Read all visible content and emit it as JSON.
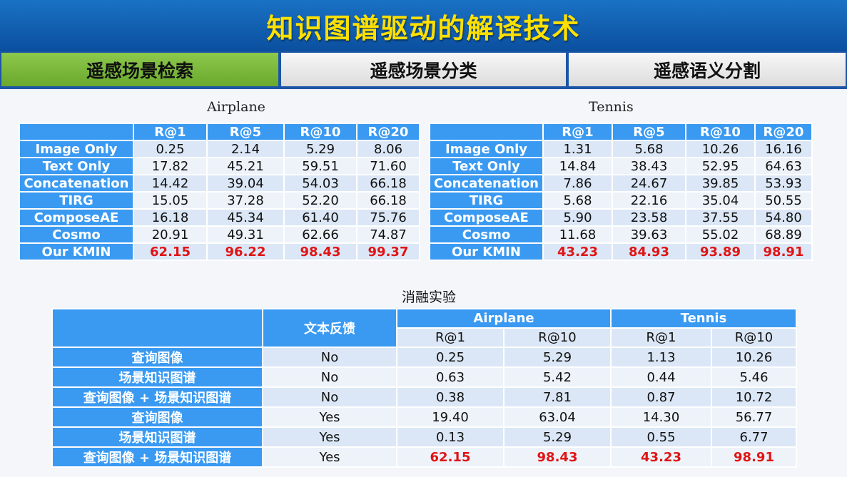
{
  "title": "知识图谱驱动的解译技术",
  "tabs": [
    {
      "label": "遥感场景检索",
      "active": true
    },
    {
      "label": "遥感场景分类",
      "active": false
    },
    {
      "label": "遥感语义分割",
      "active": false
    }
  ],
  "colors": {
    "header_blue": "#3a9af2",
    "highlight_red": "#e01414",
    "active_tab": "#7ab83e",
    "title_yellow": "#ffe000"
  },
  "tables": {
    "airplane": {
      "caption": "Airplane",
      "headers": [
        "",
        "R@1",
        "R@5",
        "R@10",
        "R@20"
      ],
      "rows": [
        {
          "label": "Image Only",
          "values": [
            "0.25",
            "2.14",
            "5.29",
            "8.06"
          ]
        },
        {
          "label": "Text Only",
          "values": [
            "17.82",
            "45.21",
            "59.51",
            "71.60"
          ]
        },
        {
          "label": "Concatenation",
          "values": [
            "14.42",
            "39.04",
            "54.03",
            "66.18"
          ]
        },
        {
          "label": "TIRG",
          "values": [
            "15.05",
            "37.28",
            "52.20",
            "66.18"
          ]
        },
        {
          "label": "ComposeAE",
          "values": [
            "16.18",
            "45.34",
            "61.40",
            "75.76"
          ]
        },
        {
          "label": "Cosmo",
          "values": [
            "20.91",
            "49.31",
            "62.66",
            "74.87"
          ]
        },
        {
          "label": "Our KMIN",
          "values": [
            "62.15",
            "96.22",
            "98.43",
            "99.37"
          ]
        }
      ]
    },
    "tennis": {
      "caption": "Tennis",
      "headers": [
        "",
        "R@1",
        "R@5",
        "R@10",
        "R@20"
      ],
      "rows": [
        {
          "label": "Image Only",
          "values": [
            "1.31",
            "5.68",
            "10.26",
            "16.16"
          ]
        },
        {
          "label": "Text Only",
          "values": [
            "14.84",
            "38.43",
            "52.95",
            "64.63"
          ]
        },
        {
          "label": "Concatenation",
          "values": [
            "7.86",
            "24.67",
            "39.85",
            "53.93"
          ]
        },
        {
          "label": "TIRG",
          "values": [
            "5.68",
            "22.16",
            "35.04",
            "50.55"
          ]
        },
        {
          "label": "ComposeAE",
          "values": [
            "5.90",
            "23.58",
            "37.55",
            "54.80"
          ]
        },
        {
          "label": "Cosmo",
          "values": [
            "11.68",
            "39.63",
            "55.02",
            "68.89"
          ]
        },
        {
          "label": "Our KMIN",
          "values": [
            "43.23",
            "84.93",
            "93.89",
            "98.91"
          ]
        }
      ]
    },
    "ablation": {
      "title": "消融实验",
      "feedback_header": "文本反馈",
      "group_headers": [
        "Airplane",
        "Tennis"
      ],
      "sub_headers": [
        "R@1",
        "R@10",
        "R@1",
        "R@10"
      ],
      "rows": [
        {
          "label": "查询图像",
          "feedback": "No",
          "values": [
            "0.25",
            "5.29",
            "1.13",
            "10.26"
          ]
        },
        {
          "label": "场景知识图谱",
          "feedback": "No",
          "values": [
            "0.63",
            "5.42",
            "0.44",
            "5.46"
          ]
        },
        {
          "label": "查询图像 + 场景知识图谱",
          "feedback": "No",
          "values": [
            "0.38",
            "7.81",
            "0.87",
            "10.72"
          ]
        },
        {
          "label": "查询图像",
          "feedback": "Yes",
          "values": [
            "19.40",
            "63.04",
            "14.30",
            "56.77"
          ]
        },
        {
          "label": "场景知识图谱",
          "feedback": "Yes",
          "values": [
            "0.13",
            "5.29",
            "0.55",
            "6.77"
          ]
        },
        {
          "label": "查询图像 + 场景知识图谱",
          "feedback": "Yes",
          "values": [
            "62.15",
            "98.43",
            "43.23",
            "98.91"
          ]
        }
      ]
    }
  }
}
